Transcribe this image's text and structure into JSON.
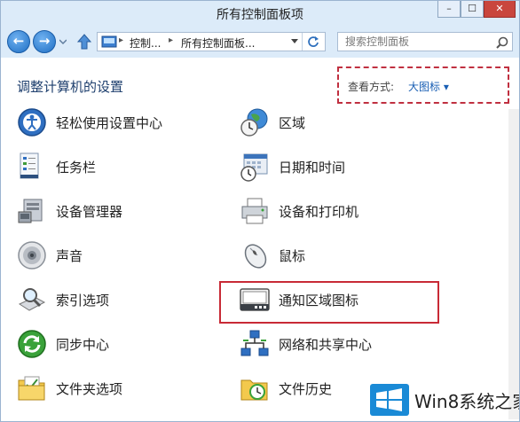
{
  "window": {
    "title": "所有控制面板项"
  },
  "titlebar": {
    "min_symbol": "–",
    "max_symbol": "☐",
    "close_symbol": "✕"
  },
  "nav": {
    "breadcrumb": [
      "控制...",
      "所有控制面板..."
    ],
    "search_placeholder": "搜索控制面板"
  },
  "header": {
    "title": "调整计算机的设置",
    "view_label": "查看方式:",
    "view_value": "大图标 ▾"
  },
  "items_left": [
    {
      "label": "轻松使用设置中心",
      "icon": "ease-of-access-icon"
    },
    {
      "label": "任务栏",
      "icon": "taskbar-icon"
    },
    {
      "label": "设备管理器",
      "icon": "device-manager-icon"
    },
    {
      "label": "声音",
      "icon": "speaker-icon"
    },
    {
      "label": "索引选项",
      "icon": "indexing-icon"
    },
    {
      "label": "同步中心",
      "icon": "sync-icon"
    },
    {
      "label": "文件夹选项",
      "icon": "folder-options-icon"
    }
  ],
  "items_right": [
    {
      "label": "区域",
      "icon": "region-icon"
    },
    {
      "label": "日期和时间",
      "icon": "calendar-clock-icon"
    },
    {
      "label": "设备和打印机",
      "icon": "printer-icon"
    },
    {
      "label": "鼠标",
      "icon": "mouse-icon"
    },
    {
      "label": "通知区域图标",
      "icon": "notification-area-icon"
    },
    {
      "label": "网络和共享中心",
      "icon": "network-icon"
    },
    {
      "label": "文件历史",
      "icon": "file-history-icon"
    }
  ],
  "watermark": {
    "text": "Win8系统之家"
  },
  "colors": {
    "accent": "#1a5fb4",
    "highlight": "#c82a36",
    "titlebar": "#dcebf9"
  }
}
